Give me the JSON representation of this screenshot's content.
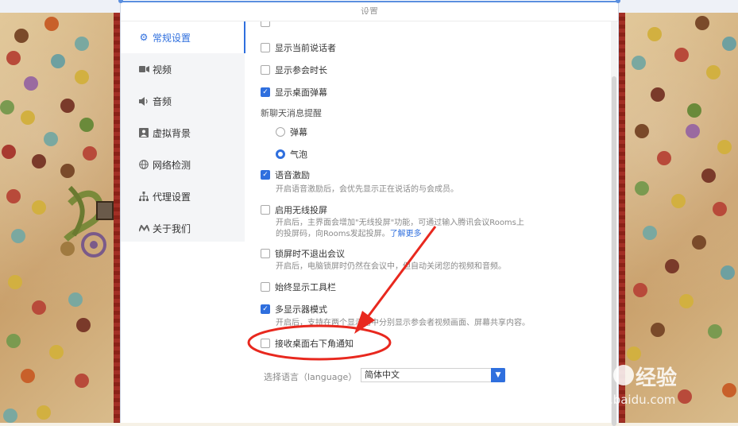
{
  "dialog": {
    "title": "设置"
  },
  "sidebar": {
    "items": [
      {
        "label": "常规设置",
        "icon": "gear-icon",
        "active": true
      },
      {
        "label": "视频",
        "icon": "camera-icon"
      },
      {
        "label": "音频",
        "icon": "speaker-icon"
      },
      {
        "label": "虚拟背景",
        "icon": "portrait-icon"
      },
      {
        "label": "网络检测",
        "icon": "globe-icon"
      },
      {
        "label": "代理设置",
        "icon": "network-icon"
      },
      {
        "label": "关于我们",
        "icon": "logo-icon"
      }
    ]
  },
  "settings": {
    "show_speaker": {
      "label": "显示当前说话者",
      "checked": false
    },
    "show_duration": {
      "label": "显示参会时长",
      "checked": false
    },
    "show_barrage": {
      "label": "显示桌面弹幕",
      "checked": true
    },
    "chat_reminder": {
      "label": "新聊天消息提醒",
      "options": [
        {
          "label": "弹幕",
          "selected": false
        },
        {
          "label": "气泡",
          "selected": true
        }
      ]
    },
    "voice_incentive": {
      "label": "语音激励",
      "checked": true,
      "desc": "开启语音激励后，会优先显示正在说话的与会成员。"
    },
    "wireless_cast": {
      "label": "启用无线投屏",
      "checked": false,
      "desc_line1": "开启后，主界面会增加\"无线投屏\"功能，可通过输入腾讯会议Rooms上",
      "desc_line2": "的投屏码，向Rooms发起投屏。",
      "link": "了解更多"
    },
    "lock_stay": {
      "label": "锁屏时不退出会议",
      "checked": false,
      "desc": "开启后，电脑锁屏时仍然在会议中，但自动关闭您的视频和音频。"
    },
    "always_toolbar": {
      "label": "始终显示工具栏",
      "checked": false
    },
    "multi_display": {
      "label": "多显示器模式",
      "checked": true,
      "desc": "开启后，支持在两个显示器中分别显示参会者视频画面、屏幕共享内容。"
    },
    "bottom_notify": {
      "label": "接收桌面右下角通知",
      "checked": false
    }
  },
  "language": {
    "label": "选择语言（language）",
    "value": "简体中文"
  },
  "annotation": {
    "color": "#e8281e"
  },
  "watermark": {
    "brand": "Bai du 经验",
    "url": "jingyan.baidu.com"
  }
}
